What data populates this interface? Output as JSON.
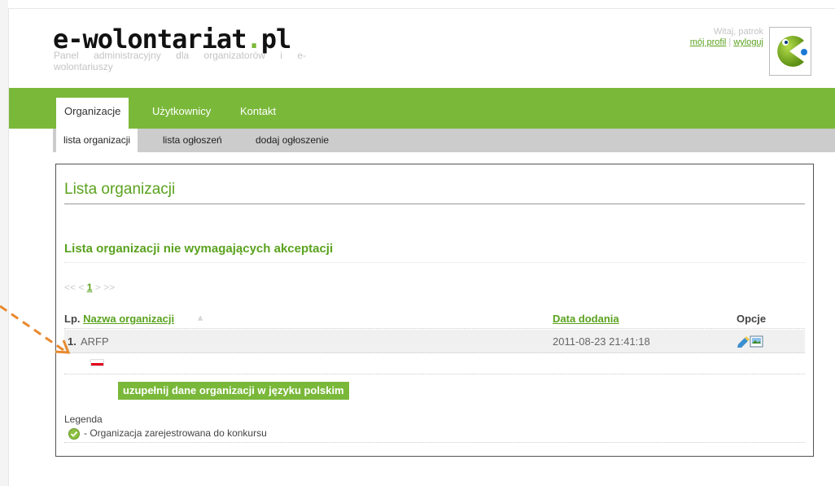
{
  "header": {
    "logo_main": "e-wolontariat",
    "logo_dot": ".",
    "logo_tld": "pl",
    "tagline": "Panel administracyjny dla organizatorów i e-wolontariuszy",
    "greeting": "Witaj, patrok",
    "profile_link": "mój profil",
    "separator": "|",
    "logout_link": "wyloguj"
  },
  "main_nav": {
    "items": [
      {
        "label": "Organizacje",
        "active": true
      },
      {
        "label": "Użytkownicy",
        "active": false
      },
      {
        "label": "Kontakt",
        "active": false
      }
    ]
  },
  "sub_nav": {
    "items": [
      {
        "label": "lista organizacji",
        "active": true
      },
      {
        "label": "lista ogłoszeń",
        "active": false
      },
      {
        "label": "dodaj ogłoszenie",
        "active": false
      }
    ]
  },
  "content": {
    "title": "Lista organizacji",
    "section_title": "Lista organizacji nie wymagających akceptacji",
    "pager": {
      "first": "<<",
      "prev": "<",
      "current": "1",
      "next": ">",
      "last": ">>"
    },
    "table": {
      "headers": {
        "lp": "Lp.",
        "name": "Nazwa organizacji",
        "sort_icon": "⩓",
        "date": "Data dodania",
        "options": "Opcje"
      },
      "rows": [
        {
          "lp": "1.",
          "name": "ARFP",
          "date": "2011-08-23 21:41:18"
        }
      ]
    },
    "tooltip": "uzupełnij dane organizacji w języku polskim",
    "legend": {
      "title": "Legenda",
      "items": [
        {
          "icon": "check-circle-icon",
          "text": "- Organizacja zarejestrowana do konkursu"
        }
      ]
    }
  },
  "colors": {
    "accent": "#7ab83a",
    "link": "#5aa21e",
    "subnav_bg": "#cccccc",
    "arrow": "#e8892e",
    "flag_red": "#e3001b"
  }
}
